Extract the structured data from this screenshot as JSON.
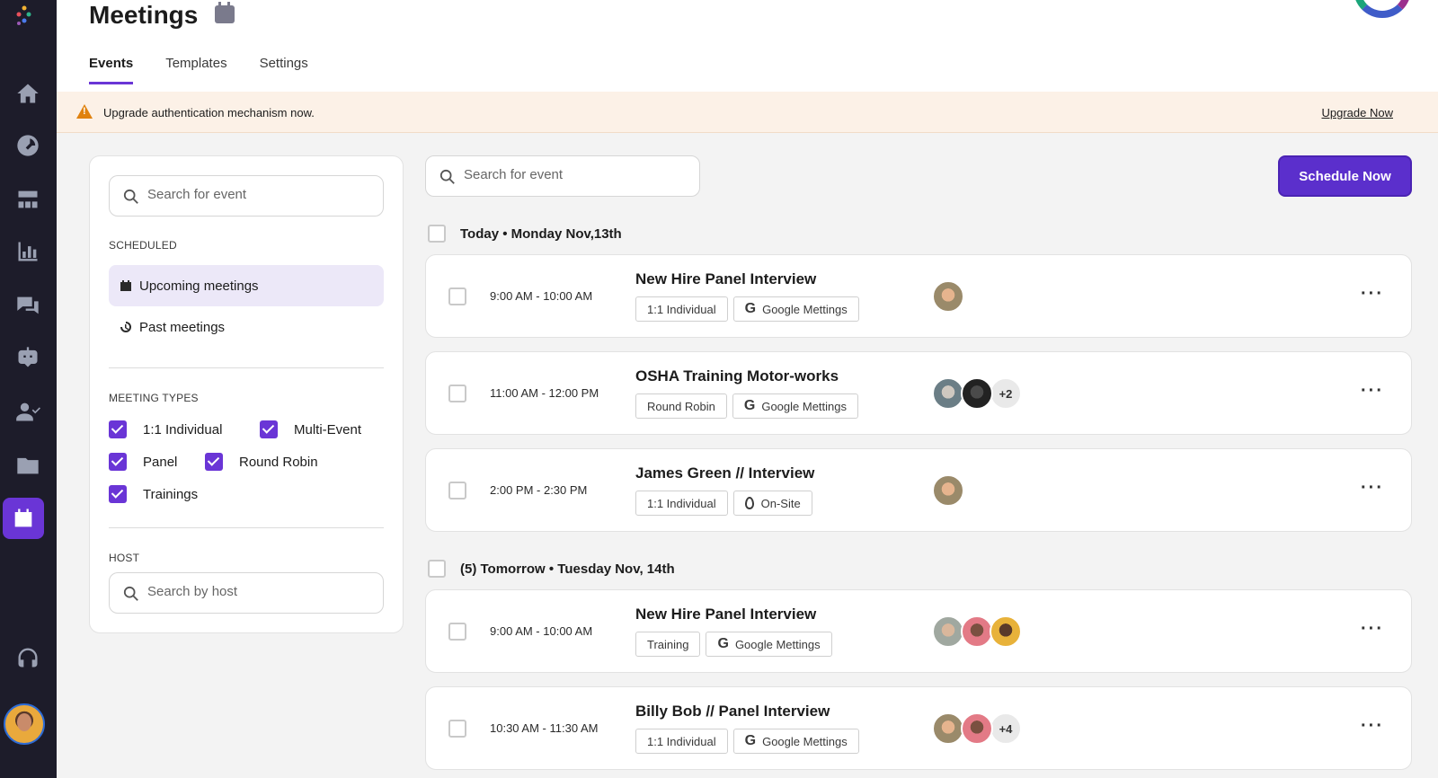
{
  "header": {
    "title": "Meetings",
    "tabs": [
      {
        "label": "Events",
        "active": true
      },
      {
        "label": "Templates",
        "active": false
      },
      {
        "label": "Settings",
        "active": false
      }
    ]
  },
  "banner": {
    "message": "Upgrade authentication mechanism now.",
    "link": "Upgrade Now"
  },
  "sidebar": {
    "search_placeholder": "Search for event",
    "scheduled_label": "SCHEDULED",
    "upcoming": "Upcoming meetings",
    "past": "Past meetings",
    "types_label": "MEETING TYPES",
    "types": [
      {
        "label": "1:1 Individual",
        "checked": true
      },
      {
        "label": "Multi-Event",
        "checked": true
      },
      {
        "label": "Panel",
        "checked": true
      },
      {
        "label": "Round Robin",
        "checked": true
      },
      {
        "label": "Trainings",
        "checked": true
      }
    ],
    "host_label": "HOST",
    "host_placeholder": "Search by host"
  },
  "main": {
    "search_placeholder": "Search for event",
    "schedule_button": "Schedule Now",
    "days": [
      {
        "label": "Today • Monday Nov,13th",
        "events": [
          {
            "time": "9:00 AM - 10:00 AM",
            "title": "New Hire Panel Interview",
            "type": "1:1 Individual",
            "location": "Google Mettings",
            "extra": ""
          },
          {
            "time": "11:00 AM - 12:00 PM",
            "title": "OSHA Training Motor-works",
            "type": "Round Robin",
            "location": "Google Mettings",
            "extra": "+2"
          },
          {
            "time": "2:00 PM - 2:30 PM",
            "title": "James Green // Interview",
            "type": "1:1 Individual",
            "location": "On-Site",
            "extra": ""
          }
        ]
      },
      {
        "label": "(5) Tomorrow • Tuesday Nov, 14th",
        "events": [
          {
            "time": "9:00 AM - 10:00 AM",
            "title": "New Hire Panel Interview",
            "type": "Training",
            "location": "Google Mettings",
            "extra": ""
          },
          {
            "time": "10:30 AM - 11:30 AM",
            "title": "Billy Bob // Panel Interview",
            "type": "1:1 Individual",
            "location": "Google Mettings",
            "extra": "+4"
          }
        ]
      }
    ]
  },
  "colors": {
    "accent": "#6a35d6",
    "rail": "#1d1c2a",
    "banner": "#fcf1e7"
  }
}
